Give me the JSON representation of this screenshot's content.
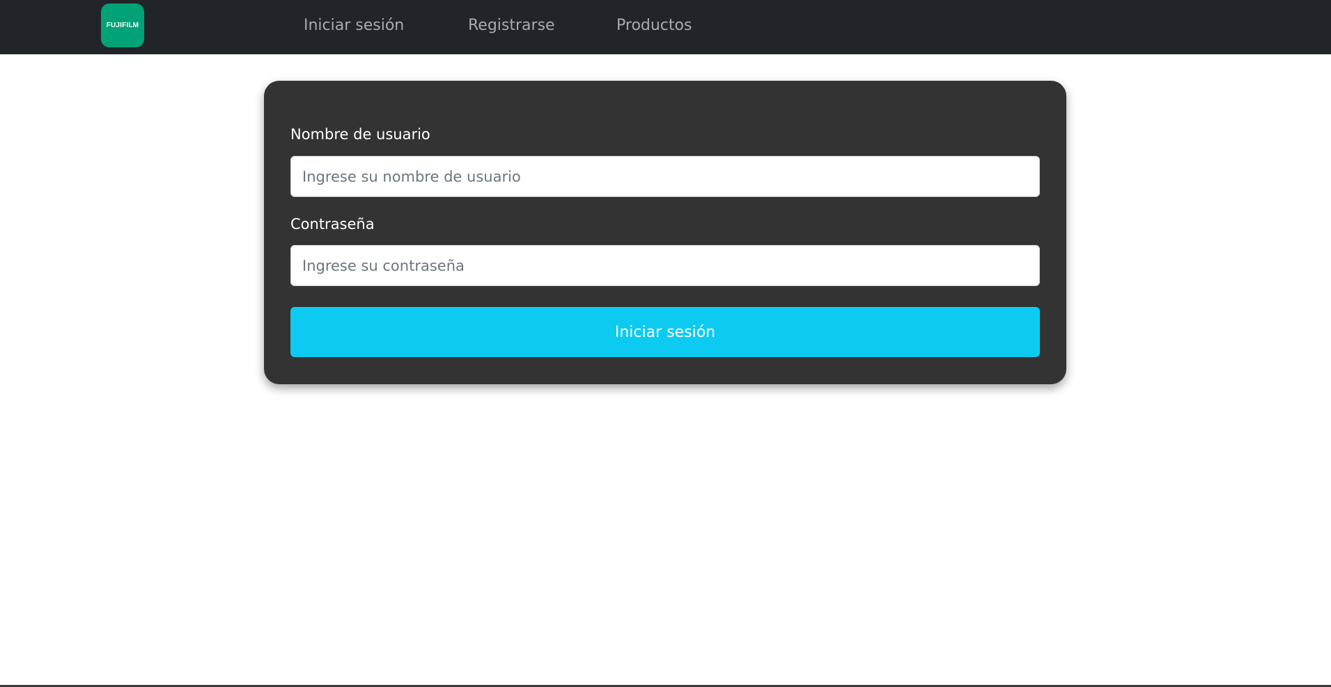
{
  "brand": {
    "logo_text": "FUJIFILM",
    "logo_color": "#00a276"
  },
  "nav": {
    "items": [
      {
        "label": "Iniciar sesión"
      },
      {
        "label": "Registrarse"
      },
      {
        "label": "Productos"
      }
    ]
  },
  "login_form": {
    "username": {
      "label": "Nombre de usuario",
      "placeholder": "Ingrese su nombre de usuario",
      "value": ""
    },
    "password": {
      "label": "Contraseña",
      "placeholder": "Ingrese su contraseña",
      "value": ""
    },
    "submit_label": "Iniciar sesión"
  },
  "colors": {
    "navbar_bg": "#212529",
    "card_bg": "#333333",
    "button_bg": "#0dcaf0",
    "nav_link": "#a9abad"
  }
}
